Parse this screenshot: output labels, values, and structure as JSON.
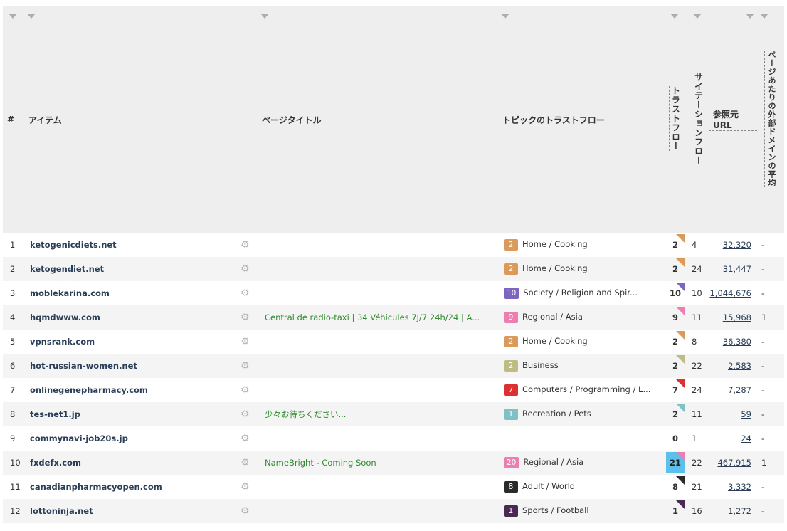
{
  "headers": {
    "num": "#",
    "item": "アイテム",
    "page_title": "ページタイトル",
    "topical_trust_flow": "トピックのトラストフロー",
    "trust_flow": "トラストフロー",
    "citation_flow": "サイテーションフロー",
    "ref_urls": "参照元URL",
    "avg_ext_domains": "ページあたりの外部ドメインの平均"
  },
  "gear_icon": "gear-icon",
  "rows": [
    {
      "num": "1",
      "item": "ketogenicdiets.net",
      "title": "",
      "badge": "2",
      "badge_color": "#d99a5b",
      "topic": "Home / Cooking",
      "tf": "2",
      "corner_color": "#d99a5b",
      "highlight": false,
      "cf": "4",
      "ref": "32,320",
      "ext": "-"
    },
    {
      "num": "2",
      "item": "ketogendiet.net",
      "title": "",
      "badge": "2",
      "badge_color": "#d99a5b",
      "topic": "Home / Cooking",
      "tf": "2",
      "corner_color": "#d99a5b",
      "highlight": false,
      "cf": "24",
      "ref": "31,447",
      "ext": "-"
    },
    {
      "num": "3",
      "item": "moblekarina.com",
      "title": "",
      "badge": "10",
      "badge_color": "#7d66c2",
      "topic": "Society / Religion and Spir...",
      "tf": "10",
      "corner_color": "#7d66c2",
      "highlight": false,
      "cf": "10",
      "ref": "1,044,676",
      "ext": "-"
    },
    {
      "num": "4",
      "item": "hqmdwww.com",
      "title": "Central de radio-taxi | 34 Véhicules 7J/7 24h/24 | A...",
      "badge": "9",
      "badge_color": "#ea7fb0",
      "topic": "Regional / Asia",
      "tf": "9",
      "corner_color": "#ea7fb0",
      "highlight": false,
      "cf": "11",
      "ref": "15,968",
      "ext": "1"
    },
    {
      "num": "5",
      "item": "vpnsrank.com",
      "title": "",
      "badge": "2",
      "badge_color": "#d99a5b",
      "topic": "Home / Cooking",
      "tf": "2",
      "corner_color": "#d99a5b",
      "highlight": false,
      "cf": "8",
      "ref": "36,380",
      "ext": "-"
    },
    {
      "num": "6",
      "item": "hot-russian-women.net",
      "title": "",
      "badge": "2",
      "badge_color": "#bdbd83",
      "topic": "Business",
      "tf": "2",
      "corner_color": "#bdbd83",
      "highlight": false,
      "cf": "22",
      "ref": "2,583",
      "ext": "-"
    },
    {
      "num": "7",
      "item": "onlinegenepharmacy.com",
      "title": "",
      "badge": "7",
      "badge_color": "#dd3030",
      "topic": "Computers / Programming / L...",
      "tf": "7",
      "corner_color": "#dd3030",
      "highlight": false,
      "cf": "24",
      "ref": "7,287",
      "ext": "-"
    },
    {
      "num": "8",
      "item": "tes-net1.jp",
      "title": "少々お待ちください...",
      "badge": "1",
      "badge_color": "#7fc1c4",
      "topic": "Recreation / Pets",
      "tf": "2",
      "corner_color": "#7fc1c4",
      "highlight": false,
      "cf": "11",
      "ref": "59",
      "ext": "-"
    },
    {
      "num": "9",
      "item": "commynavi-job20s.jp",
      "title": "",
      "badge": "",
      "badge_color": "",
      "topic": "",
      "tf": "0",
      "corner_color": "",
      "highlight": false,
      "cf": "1",
      "ref": "24",
      "ext": "-"
    },
    {
      "num": "10",
      "item": "fxdefx.com",
      "title": "NameBright - Coming Soon",
      "badge": "20",
      "badge_color": "#ea7fb0",
      "topic": "Regional / Asia",
      "tf": "21",
      "corner_color": "#ea7fb0",
      "highlight": true,
      "cf": "22",
      "ref": "467,915",
      "ext": "1"
    },
    {
      "num": "11",
      "item": "canadianpharmacyopen.com",
      "title": "",
      "badge": "8",
      "badge_color": "#2b2b2b",
      "topic": "Adult / World",
      "tf": "8",
      "corner_color": "#2b2b2b",
      "highlight": false,
      "cf": "21",
      "ref": "3,332",
      "ext": "-"
    },
    {
      "num": "12",
      "item": "lottoninja.net",
      "title": "",
      "badge": "1",
      "badge_color": "#4a2a55",
      "topic": "Sports / Football",
      "tf": "1",
      "corner_color": "#4a2a55",
      "highlight": false,
      "cf": "16",
      "ref": "1,272",
      "ext": "-"
    }
  ]
}
